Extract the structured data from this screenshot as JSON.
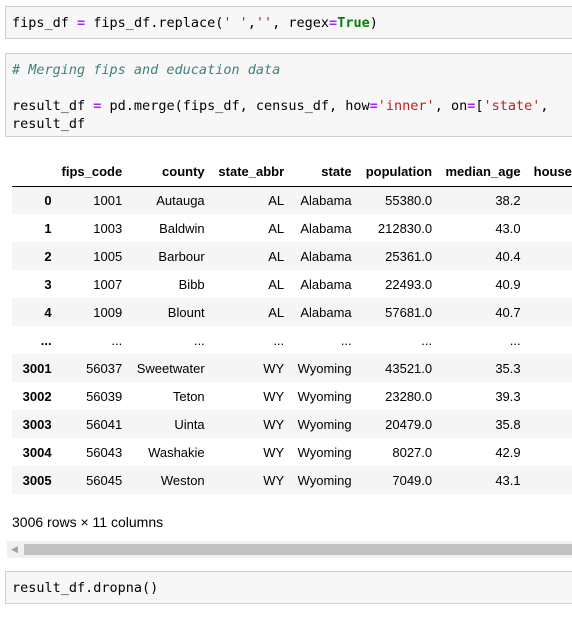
{
  "cell1": {
    "code": [
      [
        [
          "fips_df ",
          ""
        ],
        [
          "=",
          "op"
        ],
        [
          " fips_df.replace(",
          ""
        ],
        [
          "' '",
          "st"
        ],
        [
          ",",
          ""
        ],
        [
          "''",
          "st"
        ],
        [
          ", regex",
          ""
        ],
        [
          "=",
          "op"
        ],
        [
          "True",
          "kw"
        ],
        [
          ")",
          ""
        ]
      ]
    ]
  },
  "cell2": {
    "code": [
      [
        [
          "# Merging fips and education data",
          "cm"
        ]
      ],
      [
        [
          "",
          ""
        ]
      ],
      [
        [
          "result_df ",
          ""
        ],
        [
          "=",
          "op"
        ],
        [
          " pd.merge(fips_df, census_df, how",
          ""
        ],
        [
          "=",
          "op"
        ],
        [
          "'inner'",
          "st"
        ],
        [
          ", on",
          ""
        ],
        [
          "=",
          "op"
        ],
        [
          "[",
          ""
        ],
        [
          "'state'",
          "st"
        ],
        [
          ", ",
          ""
        ]
      ],
      [
        [
          "result_df",
          ""
        ]
      ]
    ]
  },
  "table": {
    "columns": [
      "fips_code",
      "county",
      "state_abbr",
      "state",
      "population",
      "median_age",
      "house"
    ],
    "rows": [
      {
        "index": "0",
        "cells": [
          "1001",
          "Autauga",
          "AL",
          "Alabama",
          "55380.0",
          "38.2",
          ""
        ]
      },
      {
        "index": "1",
        "cells": [
          "1003",
          "Baldwin",
          "AL",
          "Alabama",
          "212830.0",
          "43.0",
          ""
        ]
      },
      {
        "index": "2",
        "cells": [
          "1005",
          "Barbour",
          "AL",
          "Alabama",
          "25361.0",
          "40.4",
          ""
        ]
      },
      {
        "index": "3",
        "cells": [
          "1007",
          "Bibb",
          "AL",
          "Alabama",
          "22493.0",
          "40.9",
          ""
        ]
      },
      {
        "index": "4",
        "cells": [
          "1009",
          "Blount",
          "AL",
          "Alabama",
          "57681.0",
          "40.7",
          ""
        ]
      },
      {
        "index": "...",
        "cells": [
          "...",
          "...",
          "...",
          "...",
          "...",
          "...",
          ""
        ]
      },
      {
        "index": "3001",
        "cells": [
          "56037",
          "Sweetwater",
          "WY",
          "Wyoming",
          "43521.0",
          "35.3",
          ""
        ]
      },
      {
        "index": "3002",
        "cells": [
          "56039",
          "Teton",
          "WY",
          "Wyoming",
          "23280.0",
          "39.3",
          ""
        ]
      },
      {
        "index": "3003",
        "cells": [
          "56041",
          "Uinta",
          "WY",
          "Wyoming",
          "20479.0",
          "35.8",
          ""
        ]
      },
      {
        "index": "3004",
        "cells": [
          "56043",
          "Washakie",
          "WY",
          "Wyoming",
          "8027.0",
          "42.9",
          ""
        ]
      },
      {
        "index": "3005",
        "cells": [
          "56045",
          "Weston",
          "WY",
          "Wyoming",
          "7049.0",
          "43.1",
          ""
        ]
      }
    ]
  },
  "rows_info": "3006 rows × 11 columns",
  "scrollbar": {
    "left_arrow_icon": "triangle-left-icon"
  },
  "cell3": {
    "code": [
      [
        [
          "result_df.dropna()",
          ""
        ]
      ]
    ]
  },
  "colors": {
    "operator": "#aa22ff",
    "string": "#ba2121",
    "keyword": "#008000",
    "comment": "#408080",
    "cell_bg": "#f7f7f7",
    "stripe": "#f5f5f5"
  }
}
